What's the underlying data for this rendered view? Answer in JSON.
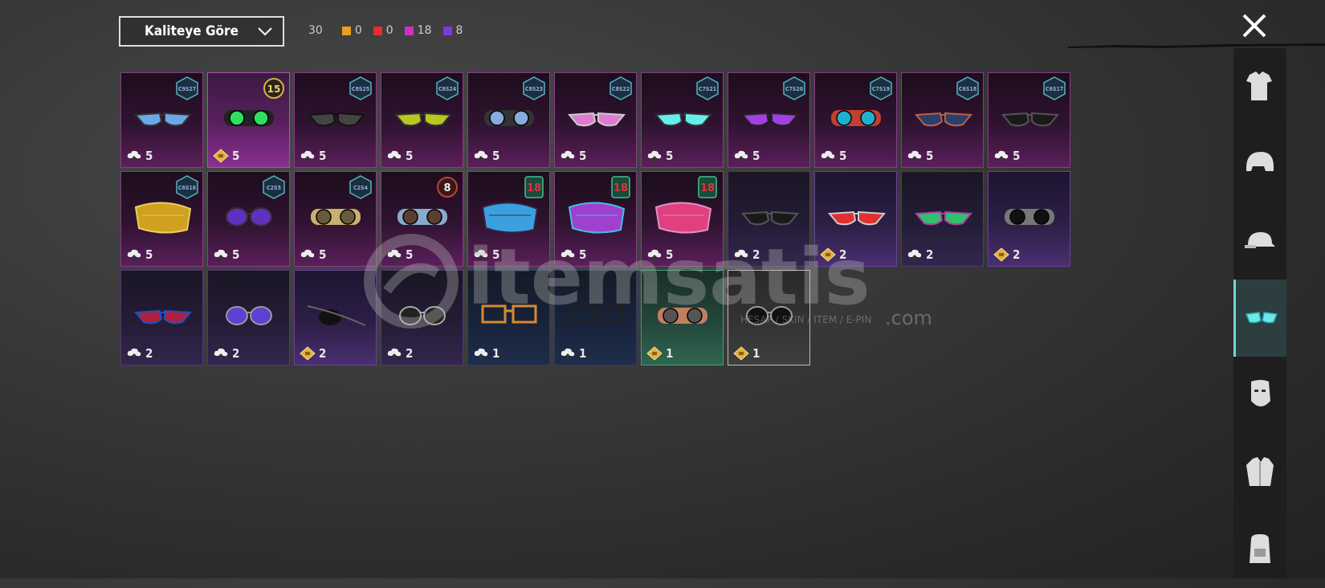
{
  "sort": {
    "label": "Kaliteye Göre"
  },
  "counts": {
    "total": "30",
    "chips": [
      {
        "value": "0",
        "color": "#e8a020"
      },
      {
        "value": "0",
        "color": "#e03030"
      },
      {
        "value": "18",
        "color": "#d030c0"
      },
      {
        "value": "8",
        "color": "#7a3ae0"
      }
    ]
  },
  "watermark": {
    "brand": "itemsatis",
    "tagline": "HESAP / SKIN / ITEM / E-PIN",
    "suffix": ".com"
  },
  "items": [
    {
      "badge": "C9S27",
      "count": "5",
      "icon": "cloud",
      "style": "",
      "glasses": "shades-blue"
    },
    {
      "badge": "15",
      "count": "5",
      "icon": "diamond",
      "style": "bright",
      "glasses": "goggle-green",
      "badgeType": "round"
    },
    {
      "badge": "C8S25",
      "count": "5",
      "icon": "cloud",
      "style": "",
      "glasses": "shades-dark"
    },
    {
      "badge": "C8S24",
      "count": "5",
      "icon": "cloud",
      "style": "",
      "glasses": "shades-yellow"
    },
    {
      "badge": "C8S23",
      "count": "5",
      "icon": "cloud",
      "style": "",
      "glasses": "goggle-cyan"
    },
    {
      "badge": "C8S22",
      "count": "5",
      "icon": "cloud",
      "style": "",
      "glasses": "shades-pink"
    },
    {
      "badge": "C7S21",
      "count": "5",
      "icon": "cloud",
      "style": "",
      "glasses": "shades-cyan"
    },
    {
      "badge": "C7S20",
      "count": "5",
      "icon": "cloud",
      "style": "",
      "glasses": "shades-purple"
    },
    {
      "badge": "C7S19",
      "count": "5",
      "icon": "cloud",
      "style": "",
      "glasses": "goggle-mech"
    },
    {
      "badge": "C6S18",
      "count": "5",
      "icon": "cloud",
      "style": "",
      "glasses": "shades-navy"
    },
    {
      "badge": "C6S17",
      "count": "5",
      "icon": "cloud",
      "style": "",
      "glasses": "shades-black"
    },
    {
      "badge": "C6S16",
      "count": "5",
      "icon": "cloud",
      "style": "",
      "glasses": "visor-gold"
    },
    {
      "badge": "C2S5",
      "count": "5",
      "icon": "cloud",
      "style": "",
      "glasses": "round-purple"
    },
    {
      "badge": "C2S4",
      "count": "5",
      "icon": "cloud",
      "style": "",
      "glasses": "goggle-steam"
    },
    {
      "badge": "8",
      "count": "5",
      "icon": "cloud",
      "style": "",
      "glasses": "goggle-brown",
      "badgeType": "round-red"
    },
    {
      "badge": "18",
      "count": "5",
      "icon": "cloud",
      "style": "",
      "glasses": "visor-neon",
      "badgeType": "tag-red"
    },
    {
      "badge": "18",
      "count": "5",
      "icon": "cloud",
      "style": "",
      "glasses": "visor-purple",
      "badgeType": "tag-red"
    },
    {
      "badge": "18",
      "count": "5",
      "icon": "cloud",
      "style": "",
      "glasses": "visor-pink",
      "badgeType": "tag-red"
    },
    {
      "badge": "",
      "count": "2",
      "icon": "cloud",
      "style": "darkpurple",
      "glasses": "cat-black"
    },
    {
      "badge": "",
      "count": "2",
      "icon": "diamond",
      "style": "purple",
      "glasses": "cat-red"
    },
    {
      "badge": "",
      "count": "2",
      "icon": "cloud",
      "style": "darkpurple",
      "glasses": "shades-green"
    },
    {
      "badge": "",
      "count": "2",
      "icon": "diamond",
      "style": "purple",
      "glasses": "goggle-black"
    },
    {
      "badge": "",
      "count": "2",
      "icon": "cloud",
      "style": "darkpurple",
      "glasses": "sport-blue"
    },
    {
      "badge": "",
      "count": "2",
      "icon": "cloud",
      "style": "darkpurple",
      "glasses": "aviator-purple"
    },
    {
      "badge": "",
      "count": "2",
      "icon": "diamond",
      "style": "purple",
      "glasses": "eyepatch"
    },
    {
      "badge": "",
      "count": "2",
      "icon": "cloud",
      "style": "darkpurple",
      "glasses": "aviator-black"
    },
    {
      "badge": "",
      "count": "1",
      "icon": "cloud",
      "style": "blue",
      "glasses": "rect-orange"
    },
    {
      "badge": "",
      "count": "1",
      "icon": "cloud",
      "style": "blue",
      "glasses": "rect-black"
    },
    {
      "badge": "",
      "count": "1",
      "icon": "diamond",
      "style": "green",
      "glasses": "goggle-copper"
    },
    {
      "badge": "",
      "count": "1",
      "icon": "diamond",
      "style": "grey",
      "glasses": "aviator-dark"
    }
  ],
  "sidebar": [
    {
      "name": "outfit-icon"
    },
    {
      "name": "helmet-icon"
    },
    {
      "name": "cap-icon"
    },
    {
      "name": "glasses-icon",
      "active": true
    },
    {
      "name": "mask-icon"
    },
    {
      "name": "jacket-icon"
    },
    {
      "name": "backpack-icon"
    }
  ]
}
